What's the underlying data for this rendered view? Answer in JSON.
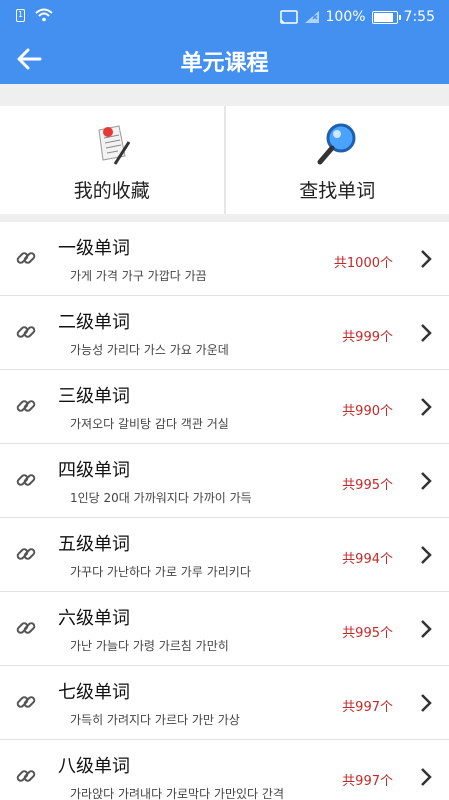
{
  "status": {
    "battery": "100%",
    "time": "7:55",
    "sim": "1"
  },
  "appbar": {
    "title": "单元课程"
  },
  "quick": {
    "favorites_label": "我的收藏",
    "search_label": "查找单词"
  },
  "units": [
    {
      "name": "一级单词",
      "words": "가게  가격  가구  가깝다  가끔",
      "count": "共1000个"
    },
    {
      "name": "二级单词",
      "words": "가능성  가리다  가스  가요  가운데",
      "count": "共999个"
    },
    {
      "name": "三级单词",
      "words": "가져오다  갈비탕  감다  객관  거실",
      "count": "共990个"
    },
    {
      "name": "四级单词",
      "words": "1인당  20대  가까워지다  가까이  가득",
      "count": "共995个"
    },
    {
      "name": "五级单词",
      "words": "가꾸다  가난하다  가로  가루  가리키다",
      "count": "共994个"
    },
    {
      "name": "六级单词",
      "words": "가난  가늘다  가령  가르침  가만히",
      "count": "共995个"
    },
    {
      "name": "七级单词",
      "words": "가득히  가려지다  가르다  가만  가상",
      "count": "共997个"
    },
    {
      "name": "八级单词",
      "words": "가라앉다  가려내다  가로막다  가만있다  간격",
      "count": "共997个"
    }
  ]
}
